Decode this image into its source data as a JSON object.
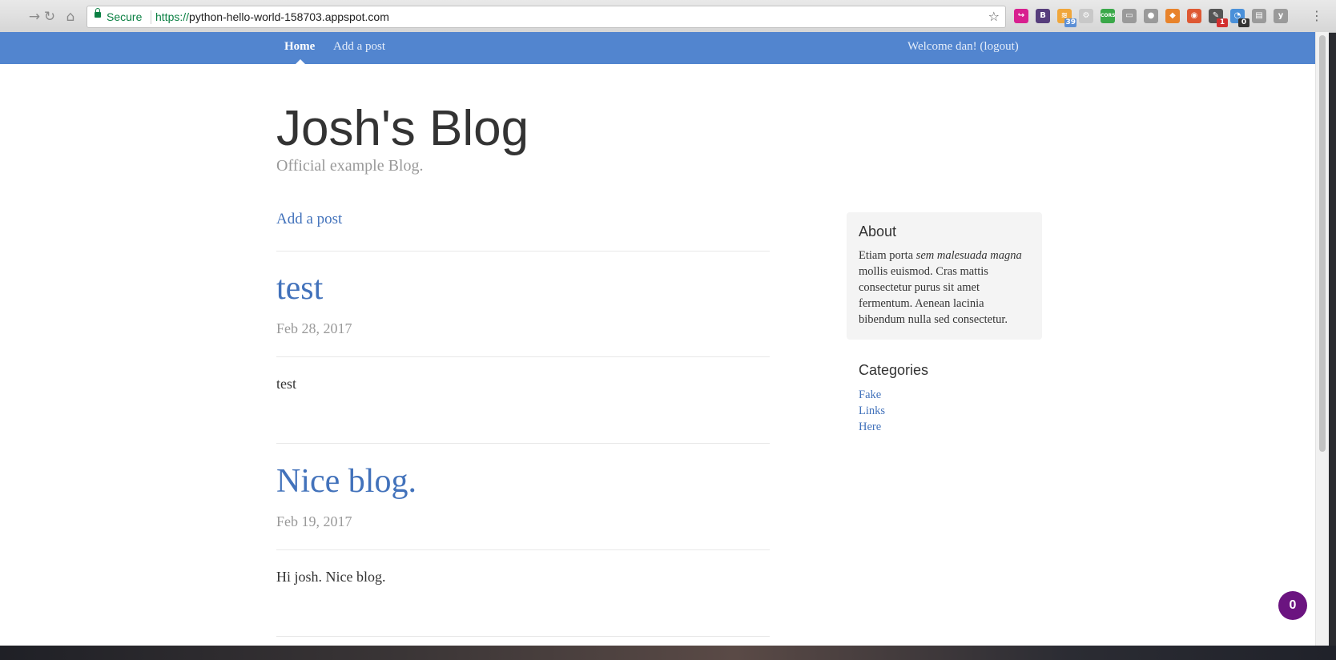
{
  "browser": {
    "secure_label": "Secure",
    "url_scheme": "https://",
    "url_host": "python-hello-world-158703.appspot.com",
    "extensions": [
      {
        "name": "pushbullet-icon",
        "color": "#d81f8f",
        "glyph": "↪",
        "badge": ""
      },
      {
        "name": "bootstrap-icon",
        "color": "#563d7c",
        "glyph": "B",
        "badge": ""
      },
      {
        "name": "rss-feed-icon",
        "color": "#f0a63a",
        "glyph": "≋",
        "badge": "39",
        "badge_color": "#5b8fd6"
      },
      {
        "name": "settings-gear-icon",
        "color": "#c8c8c8",
        "glyph": "⚙",
        "badge": ""
      },
      {
        "name": "cors-icon",
        "color": "#3aa849",
        "glyph": "CORS",
        "badge": ""
      },
      {
        "name": "cast-icon",
        "color": "#9a9a9a",
        "glyph": "▭",
        "badge": ""
      },
      {
        "name": "microphone-icon",
        "color": "#9a9a9a",
        "glyph": "●",
        "badge": ""
      },
      {
        "name": "fox-icon",
        "color": "#e8832b",
        "glyph": "◆",
        "badge": ""
      },
      {
        "name": "duckduckgo-icon",
        "color": "#de5833",
        "glyph": "◉",
        "badge": ""
      },
      {
        "name": "tool-icon",
        "color": "#555555",
        "glyph": "✎",
        "badge": "1",
        "badge_color": "#d32f2f"
      },
      {
        "name": "pie-icon",
        "color": "#4a90d9",
        "glyph": "◔",
        "badge": "0",
        "badge_color": "#333333"
      },
      {
        "name": "card-icon",
        "color": "#9a9a9a",
        "glyph": "▤",
        "badge": ""
      },
      {
        "name": "yoast-icon",
        "color": "#9a9a9a",
        "glyph": "y",
        "badge": ""
      }
    ]
  },
  "nav": {
    "home": "Home",
    "add_post": "Add a post",
    "welcome": "Welcome dan! (logout)"
  },
  "blog": {
    "title": "Josh's Blog",
    "description": "Official example Blog."
  },
  "main": {
    "add_post_link": "Add a post",
    "posts": [
      {
        "title": "test",
        "date": "Feb 28, 2017",
        "body": "test"
      },
      {
        "title": "Nice blog.",
        "date": "Feb 19, 2017",
        "body": "Hi josh. Nice blog."
      }
    ]
  },
  "sidebar": {
    "about_heading": "About",
    "about_text_1": "Etiam porta ",
    "about_text_em": "sem malesuada magna",
    "about_text_2": " mollis euismod. Cras mattis consectetur purus sit amet fermentum. Aenean lacinia bibendum nulla sed consectetur.",
    "categories_heading": "Categories",
    "categories": [
      "Fake",
      "Links",
      "Here"
    ]
  },
  "chat": {
    "count": "0"
  },
  "colors": {
    "masthead": "#5285cf",
    "link": "#4272bb",
    "chat": "#6b1480"
  }
}
